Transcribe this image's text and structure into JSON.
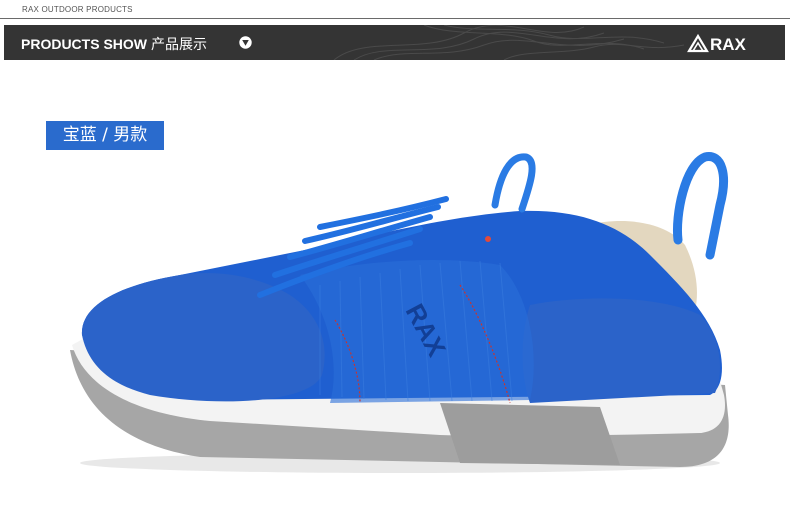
{
  "top_caption": "RAX OUTDOOR PRODUCTS",
  "header": {
    "title": "PRODUCTS SHOW",
    "subtitle": "产品展示",
    "icon": "down-triangle-icon",
    "brand": "RAX"
  },
  "variant_tag": "宝蓝 / 男款",
  "product_image": {
    "logo_text": "RAX",
    "colors": {
      "upper": "#1f5fd0",
      "suede": "#2b63c9",
      "midsole_white": "#f2f2f2",
      "midsole_grey": "#9b9b9b",
      "lining": "#e3d7bf",
      "stitch": "#c9342f"
    }
  }
}
